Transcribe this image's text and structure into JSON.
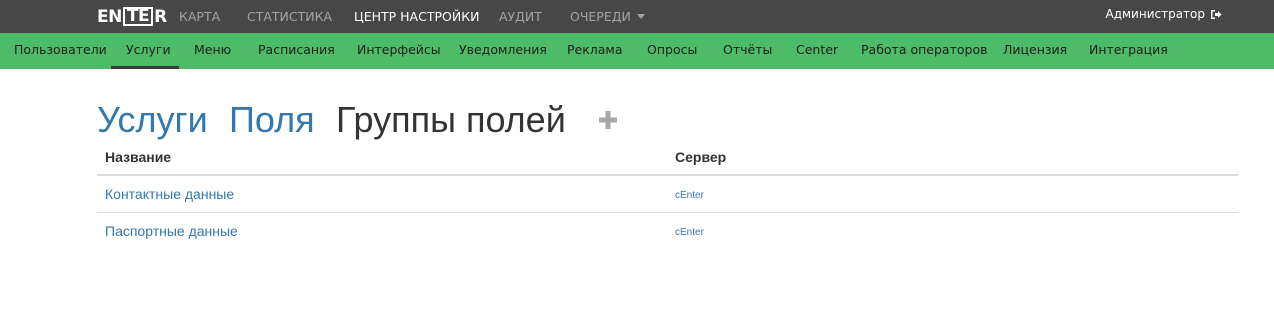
{
  "topbar": {
    "logo": {
      "text_left": "EN",
      "text_box": "T",
      "text_mid": "E",
      "text_right": "R",
      "full": "ENTER"
    },
    "nav": [
      {
        "label": "КАРТА",
        "active": false
      },
      {
        "label": "СТАТИСТИКА",
        "active": false
      },
      {
        "label": "ЦЕНТР НАСТРОЙКИ",
        "active": true
      },
      {
        "label": "АУДИТ",
        "active": false
      },
      {
        "label": "ОЧЕРЕДИ",
        "active": false,
        "dropdown": true
      }
    ],
    "user": {
      "name": "Администратор",
      "icon": "sign-out-icon"
    }
  },
  "subnav": {
    "items": [
      {
        "label": "Пользователи",
        "active": false
      },
      {
        "label": "Услуги",
        "active": true
      },
      {
        "label": "Меню",
        "active": false
      },
      {
        "label": "Расписания",
        "active": false
      },
      {
        "label": "Интерфейсы",
        "active": false
      },
      {
        "label": "Уведомления",
        "active": false
      },
      {
        "label": "Реклама",
        "active": false
      },
      {
        "label": "Опросы",
        "active": false
      },
      {
        "label": "Отчёты",
        "active": false
      },
      {
        "label": "Center",
        "active": false
      },
      {
        "label": "Работа операторов",
        "active": false
      },
      {
        "label": "Лицензия",
        "active": false
      },
      {
        "label": "Интеграция",
        "active": false
      }
    ]
  },
  "main": {
    "tabs": [
      {
        "label": "Услуги",
        "active": false
      },
      {
        "label": "Поля",
        "active": false
      },
      {
        "label": "Группы полей",
        "active": true
      }
    ],
    "add_icon": "plus-icon",
    "table": {
      "headers": [
        "Название",
        "Сервер"
      ],
      "rows": [
        {
          "name": "Контактные данные",
          "server": "cEnter"
        },
        {
          "name": "Паспортные данные",
          "server": "cEnter"
        }
      ]
    }
  },
  "colors": {
    "topbar_bg": "#474747",
    "subbar_bg": "#4dbb67",
    "link": "#3478b0",
    "nav_inactive": "#a3a3a3"
  }
}
